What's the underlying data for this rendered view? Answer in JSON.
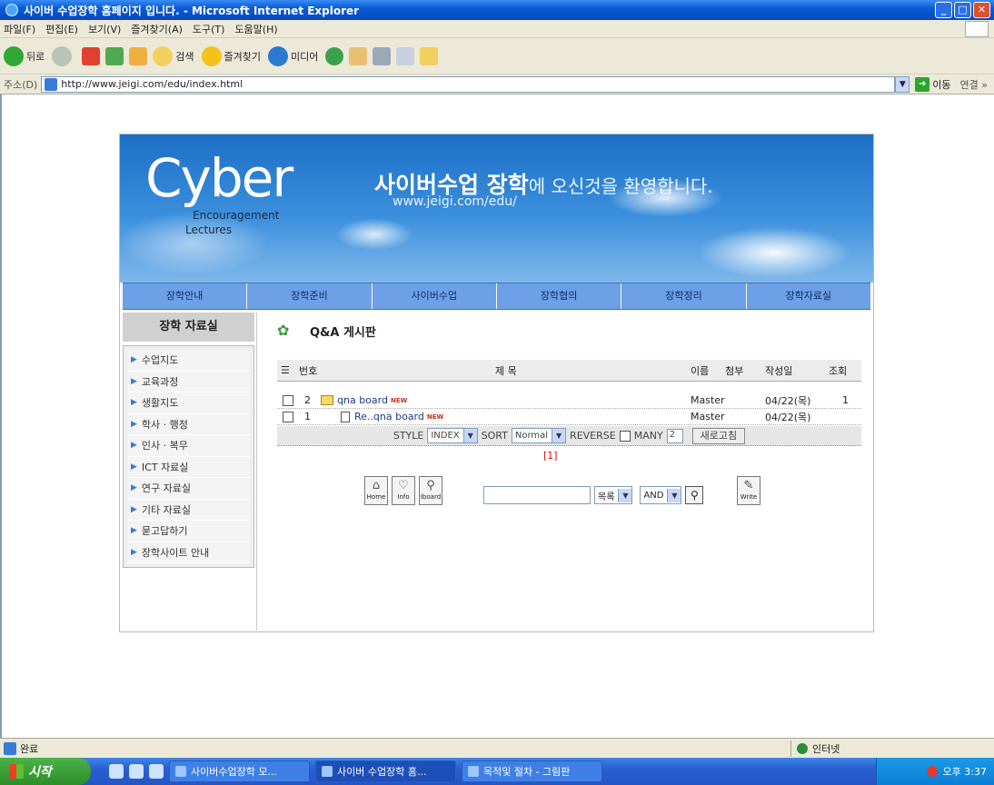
{
  "window": {
    "title": "사이버 수업장학 홈페이지 입니다. - Microsoft Internet Explorer"
  },
  "menu": [
    "파일(F)",
    "편집(E)",
    "보기(V)",
    "즐겨찾기(A)",
    "도구(T)",
    "도움말(H)"
  ],
  "toolbar": {
    "back": "뒤로",
    "search": "검색",
    "favorites": "즐겨찾기",
    "media": "미디어"
  },
  "address": {
    "label": "주소(D)",
    "url": "http://www.jeigi.com/edu/index.html",
    "go": "이동",
    "links": "연결 »"
  },
  "banner": {
    "logo_main": "Cyber",
    "logo_sub1": "Encouragement",
    "logo_sub2": "Lectures",
    "headline_bold": "사이버수업 장학",
    "headline_rest": "에 오신것을 환영합니다.",
    "url": "www.jeigi.com/edu/"
  },
  "nav": [
    "장학안내",
    "장학준비",
    "사이버수업",
    "장학협의",
    "장학정리",
    "장학자료실"
  ],
  "sidebar": {
    "title": "장학 자료실",
    "items": [
      "수업지도",
      "교육과정",
      "생활지도",
      "학사 · 행정",
      "인사 · 복무",
      "ICT 자료실",
      "연구 자료실",
      "기타 자료실",
      "묻고답하기",
      "장학사이트 안내"
    ]
  },
  "board": {
    "title": "Q&A 게시판",
    "headers": {
      "num": "번호",
      "subject": "제 목",
      "name": "이름",
      "attach": "첨부",
      "date": "작성일",
      "views": "조회"
    },
    "rows": [
      {
        "num": "2",
        "subject": "qna board",
        "new": "NEW",
        "name": "Master",
        "date": "04/22(목)",
        "views": "1"
      },
      {
        "num": "1",
        "subject": "Re..qna board",
        "new": "NEW",
        "name": "Master",
        "date": "04/22(목)",
        "views": ""
      }
    ],
    "options": {
      "style_label": "STYLE",
      "style_value": "INDEX",
      "sort_label": "SORT",
      "sort_value": "Normal",
      "reverse_label": "REVERSE",
      "many_label": "MANY",
      "many_value": "2",
      "refresh": "새로고침"
    },
    "pager": "[1]",
    "buttons": {
      "home": "Home",
      "info": "Info",
      "iboard": "Iboard",
      "write": "Write"
    },
    "search": {
      "field": "목록",
      "op": "AND"
    }
  },
  "status": {
    "text": "완료",
    "zone": "인터넷"
  },
  "taskbar": {
    "start": "시작",
    "tasks": [
      "사이버수업장학 모...",
      "사이버 수업장학 홈...",
      "목적및 절차 - 그림판"
    ],
    "clock": "오후 3:37"
  }
}
